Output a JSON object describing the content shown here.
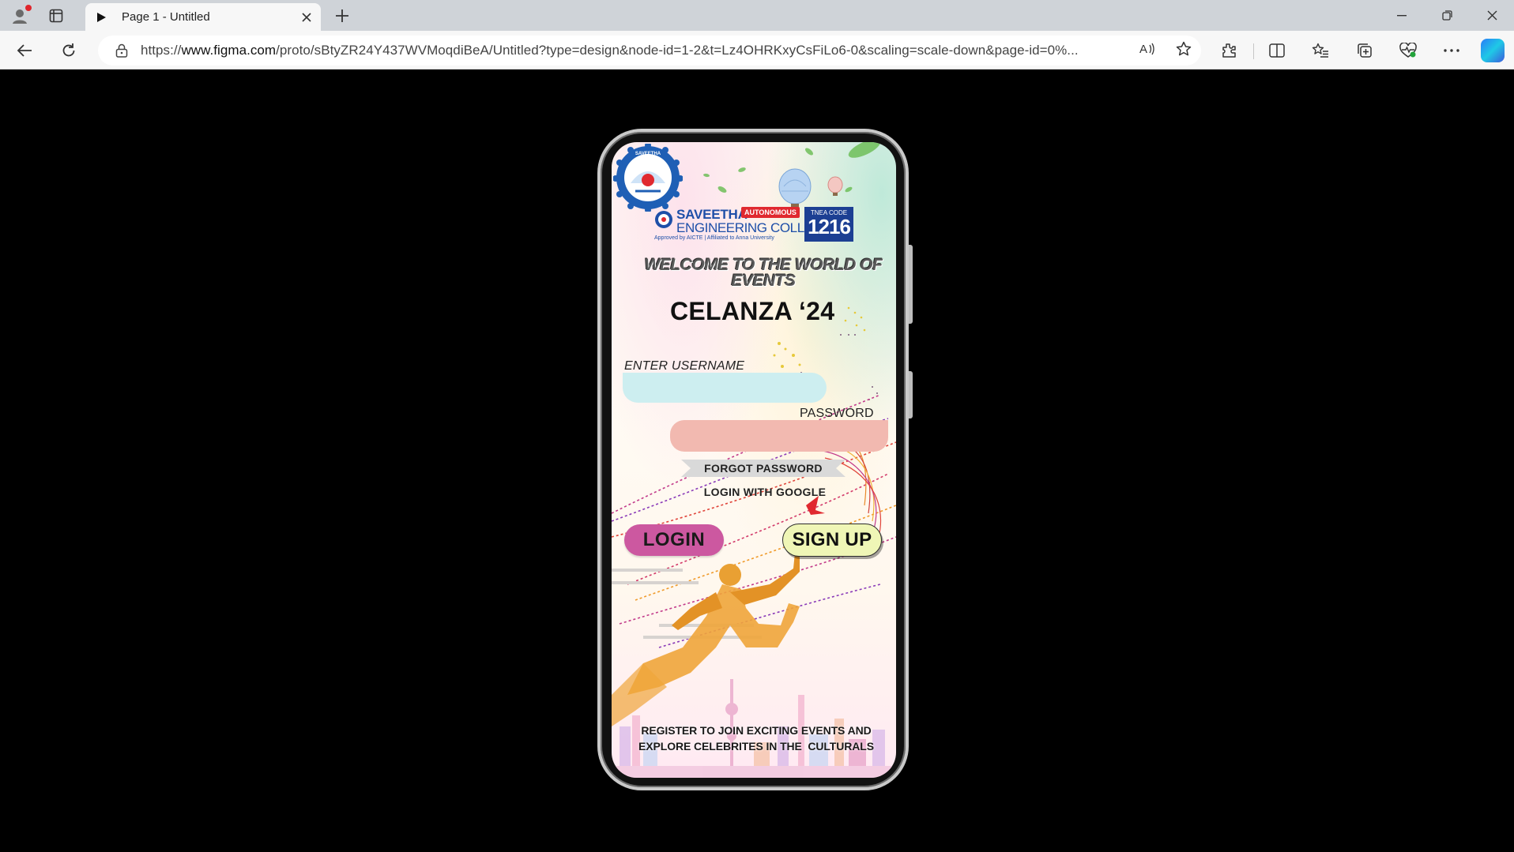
{
  "browser": {
    "tab": {
      "title": "Page 1 - Untitled"
    },
    "address_bar": {
      "url_prefix": "https://",
      "url_domain": "www.figma.com",
      "url_rest": "/proto/sBtyZR24Y437WVMoqdiBeA/Untitled?type=design&node-id=1-2&t=Lz4OHRKxyCsFiLo6-0&scaling=scale-down&page-id=0%..."
    },
    "icons": [
      "profile-icon",
      "tab-actions-icon",
      "play-icon",
      "close-icon",
      "new-tab-icon",
      "minimize-icon",
      "restore-icon",
      "window-close-icon",
      "back-icon",
      "refresh-icon",
      "lock-icon",
      "read-aloud-icon",
      "favorite-star-icon",
      "extensions-icon",
      "split-screen-icon",
      "favorites-icon",
      "collections-icon",
      "browser-essentials-icon",
      "more-icon",
      "copilot-icon"
    ]
  },
  "app": {
    "college": {
      "name": "SAVEETHA",
      "line2": "ENGINEERING COLLEGE",
      "autonomous": "AUTONOMOUS",
      "approved": "Approved by AICTE | Affiliated to Anna University",
      "tnea_label": "TNEA CODE",
      "tnea_code": "1216",
      "seal_text": "SAVEETHA"
    },
    "welcome": "WELCOME TO THE WORLD OF EVENTS",
    "event_title": "CELANZA ‘24",
    "username_label": "ENTER USERNAME",
    "password_label": "PASSWORD",
    "forgot_password": "FORGOT PASSWORD",
    "login_google": "LOGIN WITH GOOGLE",
    "login_button": "LOGIN",
    "signup_button": "SIGN UP",
    "footer_line1": "REGISTER TO JOIN EXCITING EVENTS AND",
    "footer_line2": "EXPLORE CELEBRITES IN THE  CULTURALS"
  },
  "colors": {
    "login_button": "#cc58a0",
    "signup_button": "#eff6b6",
    "username_field": "#cdeef0",
    "password_field": "#f2b9b0",
    "college_blue": "#1e4fa8",
    "tnea_box": "#1c3f93",
    "autonomous_badge": "#e0292f",
    "runner": "#f0a53a"
  }
}
